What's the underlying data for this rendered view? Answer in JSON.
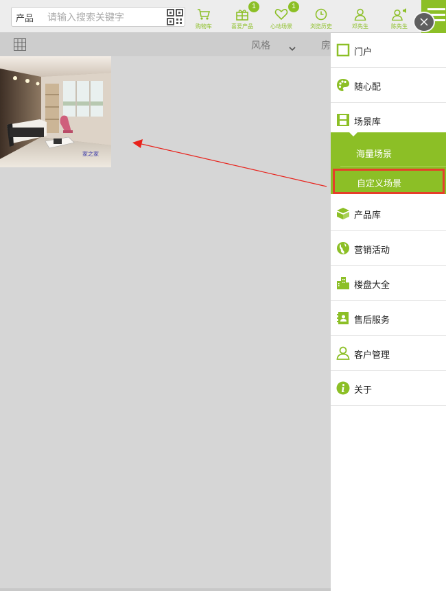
{
  "search": {
    "category": "产品",
    "placeholder": "请输入搜索关键字"
  },
  "topnav": [
    {
      "label": "购物车",
      "icon": "cart-icon"
    },
    {
      "label": "喜爱产品",
      "icon": "gift-icon",
      "badge": "1"
    },
    {
      "label": "心动场景",
      "icon": "heart-icon",
      "badge": "1"
    },
    {
      "label": "浏览历史",
      "icon": "clock-icon"
    },
    {
      "label": "邓先生",
      "icon": "user-icon"
    },
    {
      "label": "陈先生",
      "icon": "user-speaker-icon"
    }
  ],
  "subbar": {
    "style_label": "风格",
    "room_label": "房"
  },
  "scene": {
    "caption": "家之家"
  },
  "sidemenu": {
    "items": [
      {
        "label": "门户",
        "icon": "square-outline-icon"
      },
      {
        "label": "随心配",
        "icon": "palette-icon"
      },
      {
        "label": "场景库",
        "icon": "film-icon"
      },
      {
        "label": "产品库",
        "icon": "box-icon"
      },
      {
        "label": "营销活动",
        "icon": "globe-icon"
      },
      {
        "label": "楼盘大全",
        "icon": "buildings-icon"
      },
      {
        "label": "售后服务",
        "icon": "contact-book-icon"
      },
      {
        "label": "客户管理",
        "icon": "person-outline-icon"
      },
      {
        "label": "关于",
        "icon": "info-icon"
      }
    ],
    "submenu": [
      {
        "label": "海量场景"
      },
      {
        "label": "自定义场景"
      }
    ]
  },
  "colors": {
    "accent": "#8cbf26",
    "highlight_border": "#e53f2a",
    "arrow": "#e8221b"
  }
}
